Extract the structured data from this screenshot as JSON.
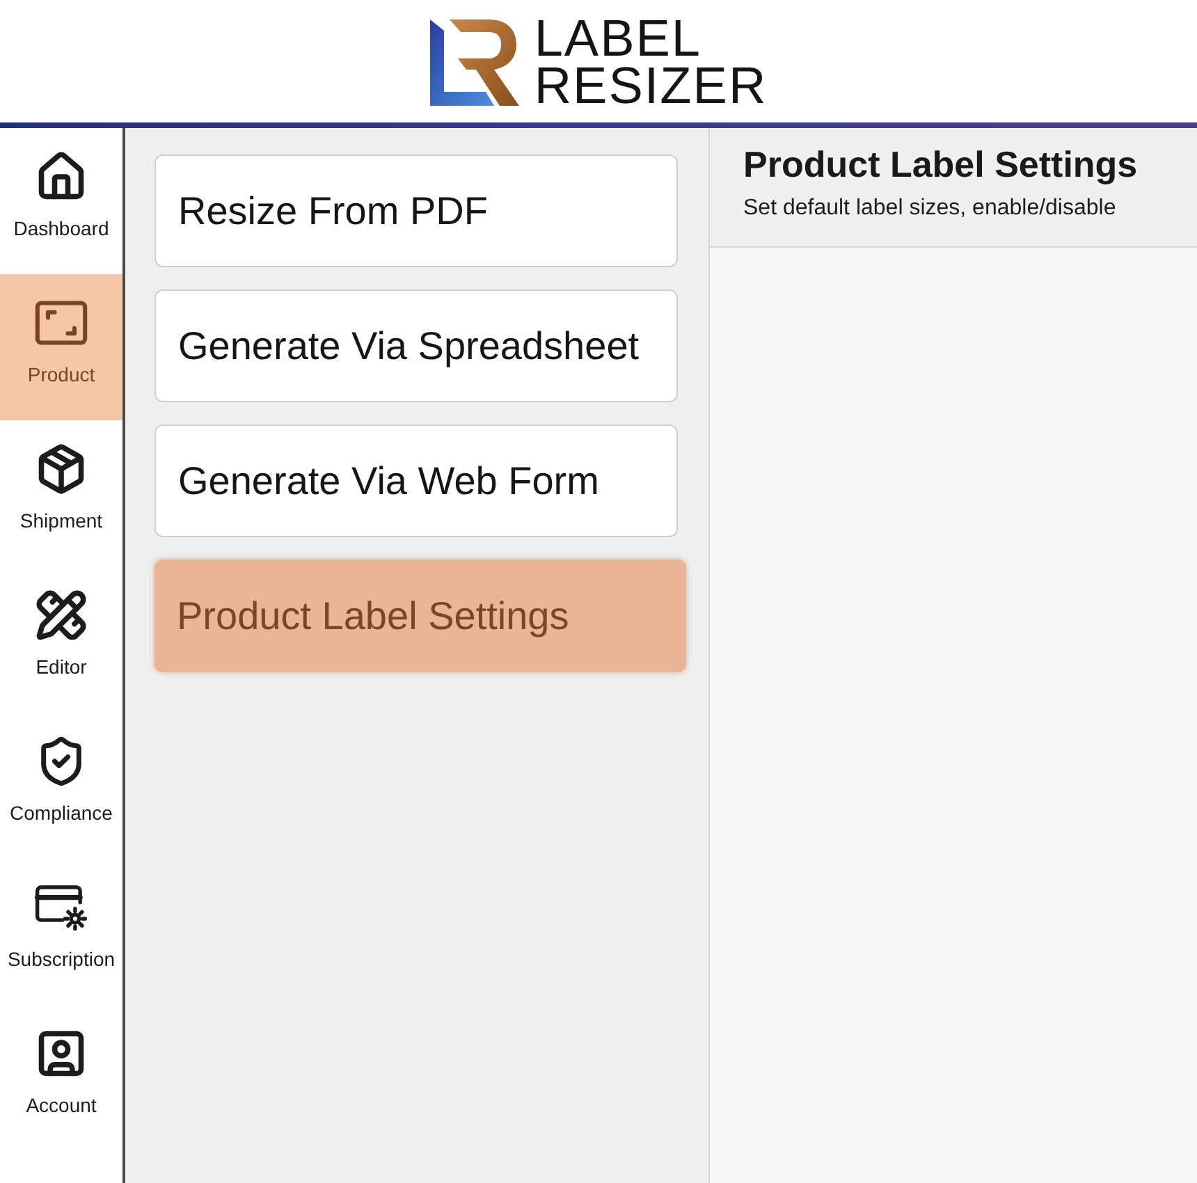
{
  "header": {
    "logo": {
      "lines": [
        "LABEL",
        "RESIZER"
      ]
    }
  },
  "sidebar": {
    "items": [
      {
        "kind": "home",
        "label": "Dashboard",
        "selected": false
      },
      {
        "kind": "frame",
        "label": "Product",
        "selected": true
      },
      {
        "kind": "box",
        "label": "Shipment",
        "selected": false
      },
      {
        "kind": "tools",
        "label": "Editor",
        "selected": false
      },
      {
        "kind": "shield",
        "label": "Compliance",
        "selected": false
      },
      {
        "kind": "card",
        "label": "Subscription",
        "selected": false
      },
      {
        "kind": "user",
        "label": "Account",
        "selected": false
      }
    ]
  },
  "menu": {
    "items": [
      {
        "label": "Resize From PDF",
        "selected": false
      },
      {
        "label": "Generate Via Spreadsheet",
        "selected": false
      },
      {
        "label": "Generate Via Web Form",
        "selected": false
      },
      {
        "label": "Product Label Settings",
        "selected": true
      }
    ]
  },
  "panel": {
    "title": "Product Label Settings",
    "subtitle": "Set default label sizes, enable/disable"
  }
}
